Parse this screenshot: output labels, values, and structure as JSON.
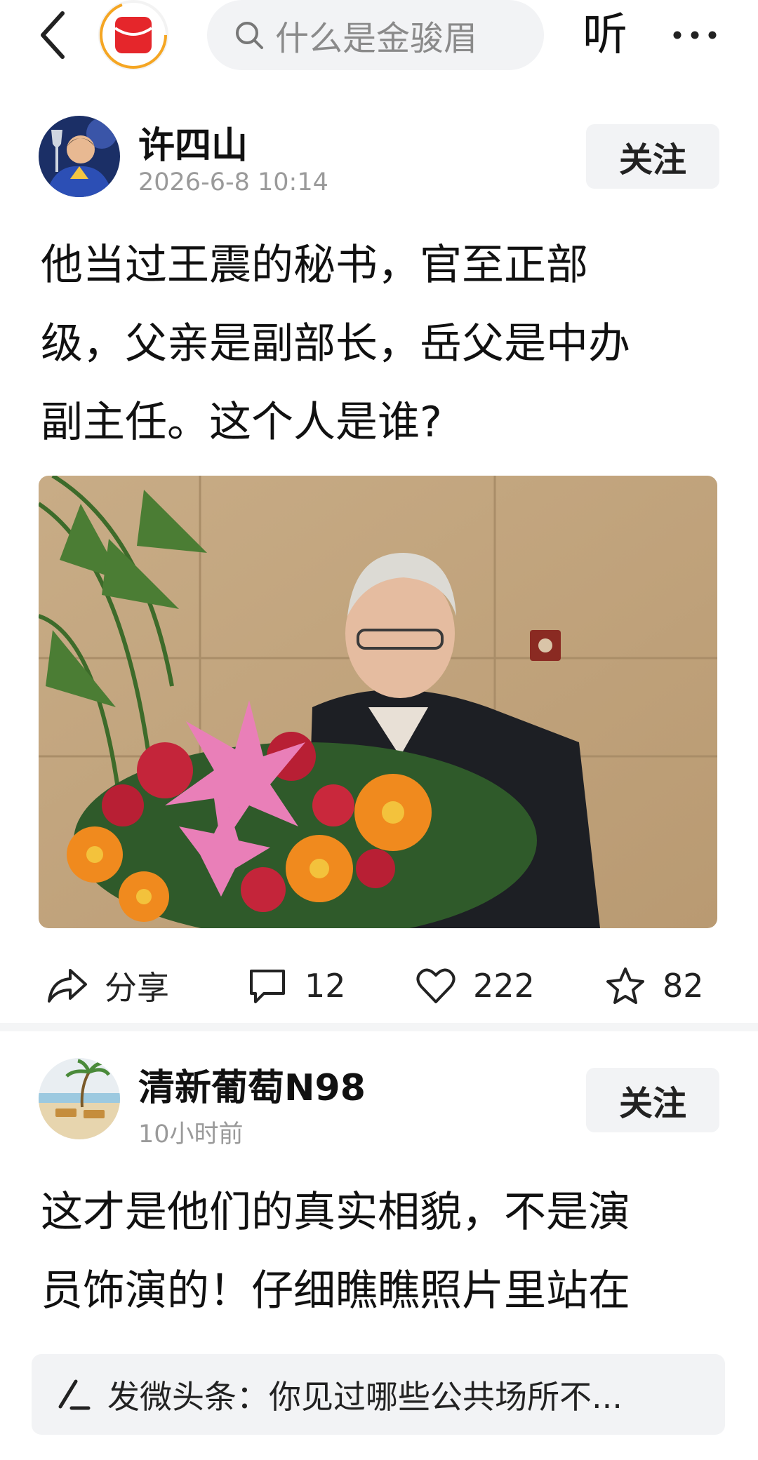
{
  "topbar": {
    "search_placeholder": "什么是金骏眉",
    "listen_label": "听"
  },
  "post1": {
    "author": "许四山",
    "time": "2026-6-8 10:14",
    "follow_label": "关注",
    "text_lines": [
      "他当过王震的秘书，官至正部",
      "级，父亲是副部长，岳父是中办",
      "副主任。这个人是谁?"
    ],
    "actions": {
      "share_label": "分享",
      "comment_count": "12",
      "like_count": "222",
      "favorite_count": "82"
    }
  },
  "post2": {
    "author": "清新葡萄N98",
    "time": "10小时前",
    "follow_label": "关注",
    "text_lines": [
      "这才是他们的真实相貌，不是演",
      "员饰演的！仔细瞧瞧照片里站在"
    ]
  },
  "bottom_bar": {
    "label": "发微头条：你见过哪些公共场所不..."
  },
  "colors": {
    "accent_red": "#e5262b",
    "follow_bg": "#f2f3f5",
    "muted_text": "#9a9a9a"
  }
}
